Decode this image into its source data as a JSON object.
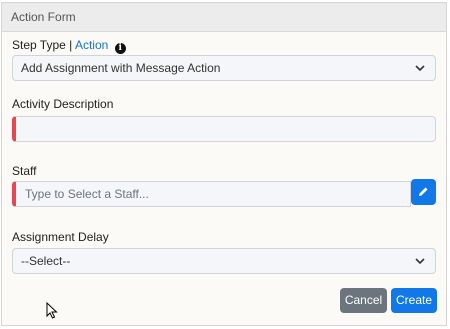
{
  "panel": {
    "title": "Action Form"
  },
  "step_type": {
    "label": "Step Type",
    "separator": "|",
    "link": "Action",
    "info_icon": "info-icon",
    "value": "Add Assignment with Message Action"
  },
  "activity": {
    "label": "Activity Description",
    "value": ""
  },
  "staff": {
    "label": "Staff",
    "placeholder": "Type to Select a Staff...",
    "edit_icon": "pencil-icon"
  },
  "assignment_delay": {
    "label": "Assignment Delay",
    "value": "--Select--"
  },
  "buttons": {
    "cancel": "Cancel",
    "create": "Create"
  },
  "colors": {
    "primary": "#1378e7",
    "secondary": "#6c757d",
    "required": "#e5484d"
  }
}
